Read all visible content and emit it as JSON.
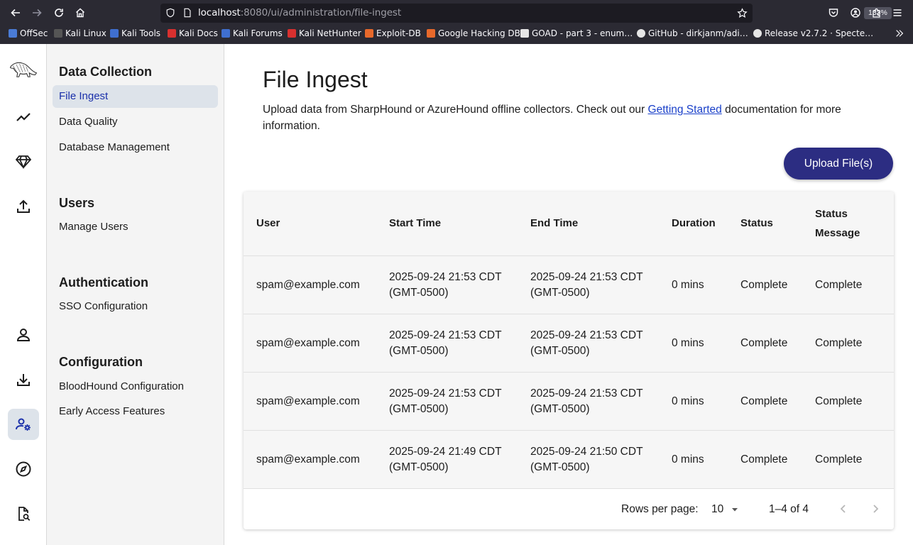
{
  "browser": {
    "url_host": "localhost",
    "url_rest": ":8080/ui/administration/file-ingest",
    "zoom": "133%",
    "bookmarks": [
      {
        "label": "OffSec",
        "color": "#4a7bd6"
      },
      {
        "label": "Kali Linux",
        "color": "#2b2a33"
      },
      {
        "label": "Kali Tools",
        "color": "#3f6fd0"
      },
      {
        "label": "Kali Docs",
        "color": "#d8302f"
      },
      {
        "label": "Kali Forums",
        "color": "#3f6fd0"
      },
      {
        "label": "Kali NetHunter",
        "color": "#d8302f"
      },
      {
        "label": "Exploit-DB",
        "color": "#e8692b"
      },
      {
        "label": "Google Hacking DB",
        "color": "#e8692b"
      },
      {
        "label": "GOAD - part 3 - enum…",
        "color": "#e6e6e6"
      },
      {
        "label": "GitHub - dirkjanm/adi…",
        "color": "#e6e6e6"
      },
      {
        "label": "Release v2.7.2 · Specte…",
        "color": "#e6e6e6"
      }
    ]
  },
  "rail": {
    "icons": [
      "bloodhound-logo-icon",
      "trend-line-icon",
      "diamond-icon",
      "upload-icon",
      "user-icon",
      "download-icon",
      "user-settings-icon",
      "compass-icon",
      "file-search-icon"
    ]
  },
  "subnav": {
    "sections": [
      {
        "heading": "Data Collection",
        "items": [
          "File Ingest",
          "Data Quality",
          "Database Management"
        ]
      },
      {
        "heading": "Users",
        "items": [
          "Manage Users"
        ]
      },
      {
        "heading": "Authentication",
        "items": [
          "SSO Configuration"
        ]
      },
      {
        "heading": "Configuration",
        "items": [
          "BloodHound Configuration",
          "Early Access Features"
        ]
      }
    ]
  },
  "main": {
    "title": "File Ingest",
    "desc_before": "Upload data from SharpHound or AzureHound offline collectors. Check out our ",
    "desc_link": "Getting Started",
    "desc_after": " documentation for more information.",
    "upload_label": "Upload File(s)",
    "columns": [
      "User",
      "Start Time",
      "End Time",
      "Duration",
      "Status",
      "Status Message"
    ],
    "rows": [
      {
        "user": "spam@example.com",
        "start": "2025-09-24 21:53 CDT",
        "start_tz": "(GMT-0500)",
        "end": "2025-09-24 21:53 CDT",
        "end_tz": "(GMT-0500)",
        "duration": "0 mins",
        "status": "Complete",
        "message": "Complete"
      },
      {
        "user": "spam@example.com",
        "start": "2025-09-24 21:53 CDT",
        "start_tz": "(GMT-0500)",
        "end": "2025-09-24 21:53 CDT",
        "end_tz": "(GMT-0500)",
        "duration": "0 mins",
        "status": "Complete",
        "message": "Complete"
      },
      {
        "user": "spam@example.com",
        "start": "2025-09-24 21:53 CDT",
        "start_tz": "(GMT-0500)",
        "end": "2025-09-24 21:53 CDT",
        "end_tz": "(GMT-0500)",
        "duration": "0 mins",
        "status": "Complete",
        "message": "Complete"
      },
      {
        "user": "spam@example.com",
        "start": "2025-09-24 21:49 CDT",
        "start_tz": "(GMT-0500)",
        "end": "2025-09-24 21:50 CDT",
        "end_tz": "(GMT-0500)",
        "duration": "0 mins",
        "status": "Complete",
        "message": "Complete"
      }
    ],
    "footer": {
      "rows_per_page_label": "Rows per page:",
      "rows_per_page_value": "10",
      "range": "1–4 of 4"
    }
  }
}
